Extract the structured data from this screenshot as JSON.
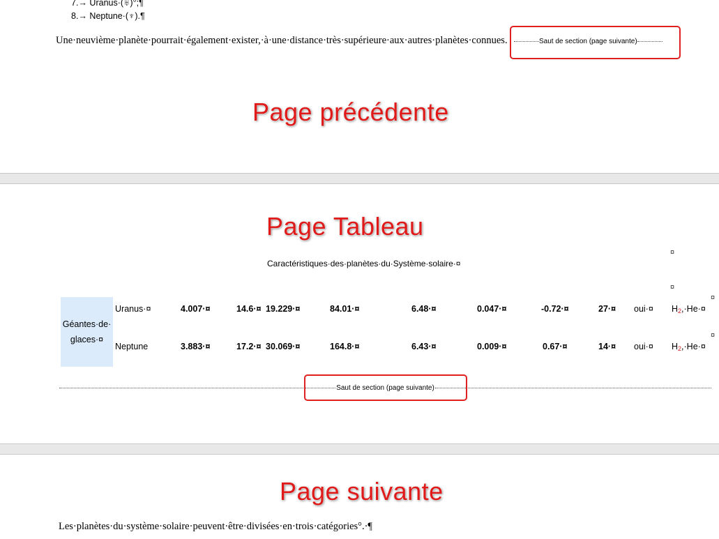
{
  "doc": {
    "list_items": [
      {
        "num": "7.",
        "text": "Uranus·(♅)",
        "tail": "°;¶"
      },
      {
        "num": "8.",
        "text": "Neptune·(♆).¶",
        "tail": ""
      }
    ],
    "intro_paragraph": "Une·neuvième·planète·pourrait·également·exister,·à·une·distance·très·supérieure·aux·autres·planètes·connues.",
    "section_break_label": "Saut de section (page suivante)",
    "table_caption": "Caractéristiques·des·planètes·du·Système·solaire·¤",
    "cell_mark": "¤",
    "group_label": "Géantes·de·glaces·¤",
    "group_label_line1": "Géantes·de·",
    "group_label_line2": "glaces·¤",
    "rows": [
      {
        "name": "Uranus·¤",
        "v1": "4.007·¤",
        "v2": "14.6·¤",
        "v3": "19.229·¤",
        "v4": "84.01·¤",
        "v5": "6.48·¤",
        "v6": "0.047·¤",
        "v7": "-0.72·¤",
        "v8": "27·¤",
        "v9": "oui·¤",
        "gas_a": "H",
        "gas_sub": "2",
        "gas_b": ",·He·¤"
      },
      {
        "name": "Neptune",
        "v1": "3.883·¤",
        "v2": "17.2·¤",
        "v3": "30.069·¤",
        "v4": "164.8·¤",
        "v5": "6.43·¤",
        "v6": "0.009·¤",
        "v7": "0.67·¤",
        "v8": "14·¤",
        "v9": "oui·¤",
        "gas_a": "H",
        "gas_sub": "2",
        "gas_b": ",·He·¤"
      }
    ],
    "next_paragraph": "Les·planètes·du·système·solaire·peuvent·être·divisées·en·trois·catégories°.·¶"
  },
  "annotations": {
    "prev_page": "Page précédente",
    "table_page": "Page Tableau",
    "next_page": "Page suivante"
  },
  "colors": {
    "annotation_red": "#e01919",
    "group_cell_bg": "#dbebfb",
    "page_gap": "#e8e8e8"
  }
}
